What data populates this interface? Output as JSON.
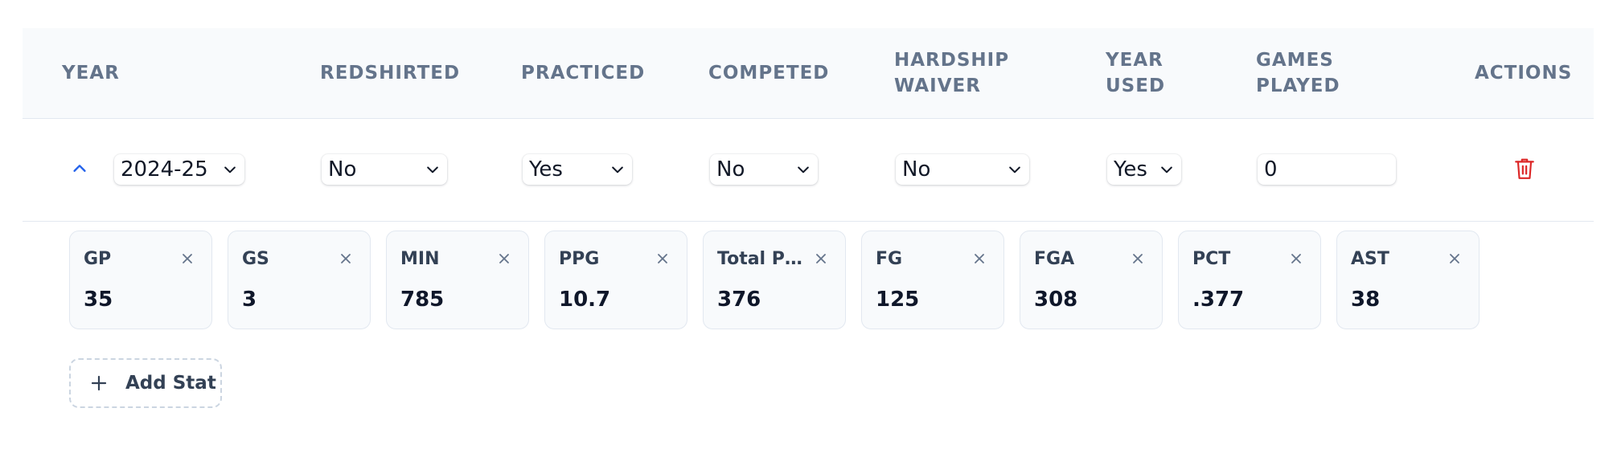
{
  "table": {
    "headers": {
      "year": "YEAR",
      "redshirted": "REDSHIRTED",
      "practiced": "PRACTICED",
      "competed": "COMPETED",
      "hardship_waiver_1": "HARDSHIP",
      "hardship_waiver_2": "WAIVER",
      "year_used_1": "YEAR",
      "year_used_2": "USED",
      "games_played_1": "GAMES",
      "games_played_2": "PLAYED",
      "actions": "ACTIONS"
    },
    "row": {
      "year": "2024-25",
      "redshirted": "No",
      "practiced": "Yes",
      "competed": "No",
      "hardship_waiver": "No",
      "year_used": "Yes",
      "games_played": "0"
    }
  },
  "stats": [
    {
      "label": "GP",
      "value": "35"
    },
    {
      "label": "GS",
      "value": "3"
    },
    {
      "label": "MIN",
      "value": "785"
    },
    {
      "label": "PPG",
      "value": "10.7"
    },
    {
      "label": "Total Points",
      "value": "376"
    },
    {
      "label": "FG",
      "value": "125"
    },
    {
      "label": "FGA",
      "value": "308"
    },
    {
      "label": "PCT",
      "value": ".377"
    },
    {
      "label": "AST",
      "value": "38"
    }
  ],
  "add_stat_label": "Add Stat",
  "colors": {
    "accent": "#2563eb",
    "danger": "#dc2626",
    "header_bg": "#f8fafc",
    "border": "#e2e8f0"
  },
  "icons": {
    "expand": "chevron-up-icon",
    "select": "chevron-down-icon",
    "delete": "trash-icon",
    "remove": "close-icon",
    "add": "plus-icon"
  }
}
